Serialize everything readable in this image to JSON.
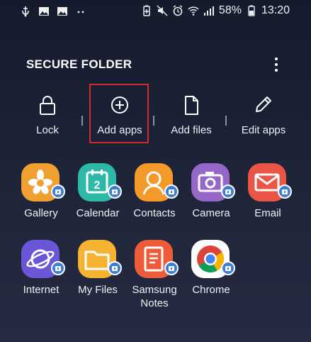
{
  "status_bar": {
    "left_icons": [
      "usb-debug-icon",
      "image-icon",
      "image-icon",
      "more-notifications-icon"
    ],
    "right_icons": [
      "battery-saver-icon",
      "mute-icon",
      "alarm-icon",
      "wifi-icon",
      "signal-icon"
    ],
    "battery": "58%",
    "time": "13:20"
  },
  "header": {
    "title": "SECURE FOLDER",
    "menu_icon": "more-vert-icon"
  },
  "actions": [
    {
      "label": "Lock",
      "icon": "lock-icon"
    },
    {
      "label": "Add apps",
      "icon": "add-circle-icon",
      "highlighted": true,
      "highlight_color": "#d42a2a"
    },
    {
      "label": "Add files",
      "icon": "file-icon"
    },
    {
      "label": "Edit apps",
      "icon": "pencil-icon"
    }
  ],
  "apps": [
    {
      "label": "Gallery",
      "icon": "gallery-icon",
      "color": "#f0a030"
    },
    {
      "label": "Calendar",
      "icon": "calendar-icon",
      "color": "#2eb8a8"
    },
    {
      "label": "Contacts",
      "icon": "contacts-icon",
      "color": "#f39a2a"
    },
    {
      "label": "Camera",
      "icon": "camera-icon",
      "color": "#9467c9"
    },
    {
      "label": "Email",
      "icon": "email-icon",
      "color": "#ea5546"
    },
    {
      "label": "Internet",
      "icon": "internet-icon",
      "color": "#6a56d6"
    },
    {
      "label": "My Files",
      "icon": "my-files-icon",
      "color": "#f5b331"
    },
    {
      "label": "Samsung\nNotes",
      "icon": "notes-icon",
      "color": "#ee5b3b"
    },
    {
      "label": "Chrome",
      "icon": "chrome-icon",
      "color": "#ffffff"
    }
  ]
}
